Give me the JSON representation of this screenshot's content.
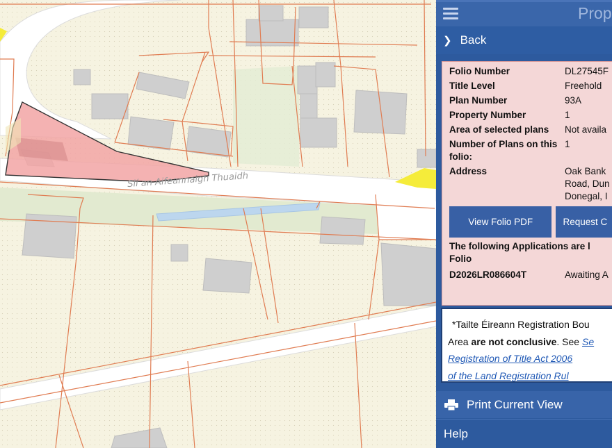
{
  "map": {
    "road_label": "Slí an Aifeannaigh Thuaidh"
  },
  "panel": {
    "title": "Prop",
    "back_label": "Back",
    "folio": {
      "fields": [
        {
          "label": "Folio Number",
          "value": "DL27545F"
        },
        {
          "label": "Title Level",
          "value": "Freehold"
        },
        {
          "label": "Plan Number",
          "value": "93A"
        },
        {
          "label": "Property Number",
          "value": "1"
        },
        {
          "label": "Area of selected plans",
          "value": "Not availa"
        },
        {
          "label": "Number of Plans on this folio:",
          "value": "1"
        },
        {
          "label": "Address",
          "value": [
            "Oak Bank",
            "Road, Dun",
            "Donegal, I"
          ]
        }
      ],
      "view_pdf_label": "View Folio PDF",
      "request_label": "Request C",
      "applications_heading": [
        "The following Applications are l",
        "Folio"
      ],
      "applications": [
        {
          "ref": "D2026LR086604T",
          "status": "Awaiting A"
        }
      ]
    },
    "notice": {
      "line1": "*Tailte Éireann Registration Bou",
      "line2_pre": "Area ",
      "line2_bold": "are not conclusive",
      "line2_post": ". See ",
      "line2_link": "Se",
      "link_line1": "Registration of Title Act 2006",
      "link_line2": "of the Land Registration Rul"
    },
    "print_label": "Print Current View",
    "help_label": "Help"
  },
  "colors": {
    "panel_bg": "#2d5a9e",
    "folio_bg": "#f4d7d7",
    "selected_parcel": "#f2a5a5",
    "highlight_yellow": "#f5ec3a"
  }
}
